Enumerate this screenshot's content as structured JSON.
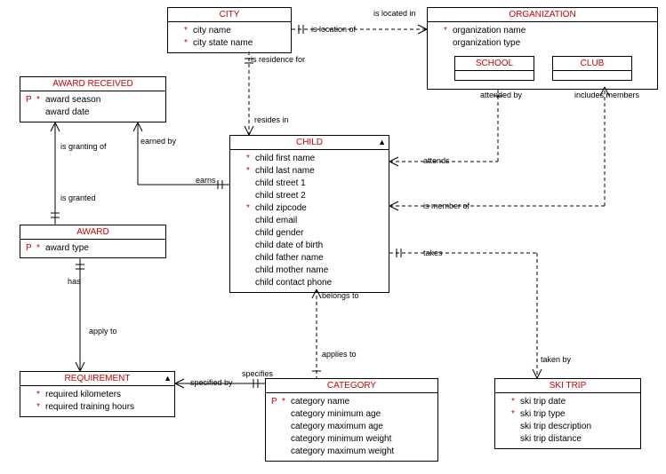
{
  "entities": {
    "city": {
      "title": "CITY",
      "attrs": [
        {
          "p": "",
          "star": "*",
          "name": "city name"
        },
        {
          "p": "",
          "star": "*",
          "name": "city state name"
        }
      ]
    },
    "organization": {
      "title": "ORGANIZATION",
      "attrs": [
        {
          "p": "",
          "star": "*",
          "name": "organization name"
        },
        {
          "p": "",
          "star": "",
          "name": "organization type"
        }
      ],
      "subtypes": {
        "school": "SCHOOL",
        "club": "CLUB"
      }
    },
    "award_received": {
      "title": "AWARD RECEIVED",
      "attrs": [
        {
          "p": "P",
          "star": "*",
          "name": "award season"
        },
        {
          "p": "",
          "star": "",
          "name": "award date"
        }
      ]
    },
    "child": {
      "title": "CHILD",
      "attrs": [
        {
          "p": "",
          "star": "*",
          "name": "child first name"
        },
        {
          "p": "",
          "star": "*",
          "name": "child last name"
        },
        {
          "p": "",
          "star": "",
          "name": "child street 1"
        },
        {
          "p": "",
          "star": "",
          "name": "child street 2"
        },
        {
          "p": "",
          "star": "*",
          "name": "child zipcode"
        },
        {
          "p": "",
          "star": "",
          "name": "child email"
        },
        {
          "p": "",
          "star": "",
          "name": "child gender"
        },
        {
          "p": "",
          "star": "",
          "name": "child date of birth"
        },
        {
          "p": "",
          "star": "",
          "name": "child father name"
        },
        {
          "p": "",
          "star": "",
          "name": "child mother name"
        },
        {
          "p": "",
          "star": "",
          "name": "child contact phone"
        }
      ]
    },
    "award": {
      "title": "AWARD",
      "attrs": [
        {
          "p": "P",
          "star": "*",
          "name": "award type"
        }
      ]
    },
    "requirement": {
      "title": "REQUIREMENT",
      "attrs": [
        {
          "p": "",
          "star": "*",
          "name": "required kilometers"
        },
        {
          "p": "",
          "star": "*",
          "name": "required training hours"
        }
      ]
    },
    "category": {
      "title": "CATEGORY",
      "attrs": [
        {
          "p": "P",
          "star": "*",
          "name": "category name"
        },
        {
          "p": "",
          "star": "",
          "name": "category minimum age"
        },
        {
          "p": "",
          "star": "",
          "name": "category maximum age"
        },
        {
          "p": "",
          "star": "",
          "name": "category minimum weight"
        },
        {
          "p": "",
          "star": "",
          "name": "category maximum weight"
        }
      ]
    },
    "ski_trip": {
      "title": "SKI TRIP",
      "attrs": [
        {
          "p": "",
          "star": "*",
          "name": "ski trip date"
        },
        {
          "p": "",
          "star": "*",
          "name": "ski trip type"
        },
        {
          "p": "",
          "star": "",
          "name": "ski trip description"
        },
        {
          "p": "",
          "star": "",
          "name": "ski trip distance"
        }
      ]
    }
  },
  "relations": {
    "is_location_of": "is location of",
    "is_located_in": "is located in",
    "is_residence_for": "is residence for",
    "resides_in": "resides in",
    "is_granting_of": "is granting of",
    "earned_by": "earned by",
    "earns": "earns",
    "is_granted": "is granted",
    "has": "has",
    "apply_to": "apply to",
    "specified_by": "specified by",
    "specifies": "specifies",
    "belongs_to": "belongs to",
    "applies_to": "applies to",
    "attends": "attends",
    "attended_by": "attended by",
    "is_member_of": "is member of",
    "includes_members": "includes members",
    "takes": "takes",
    "taken_by": "taken by"
  }
}
